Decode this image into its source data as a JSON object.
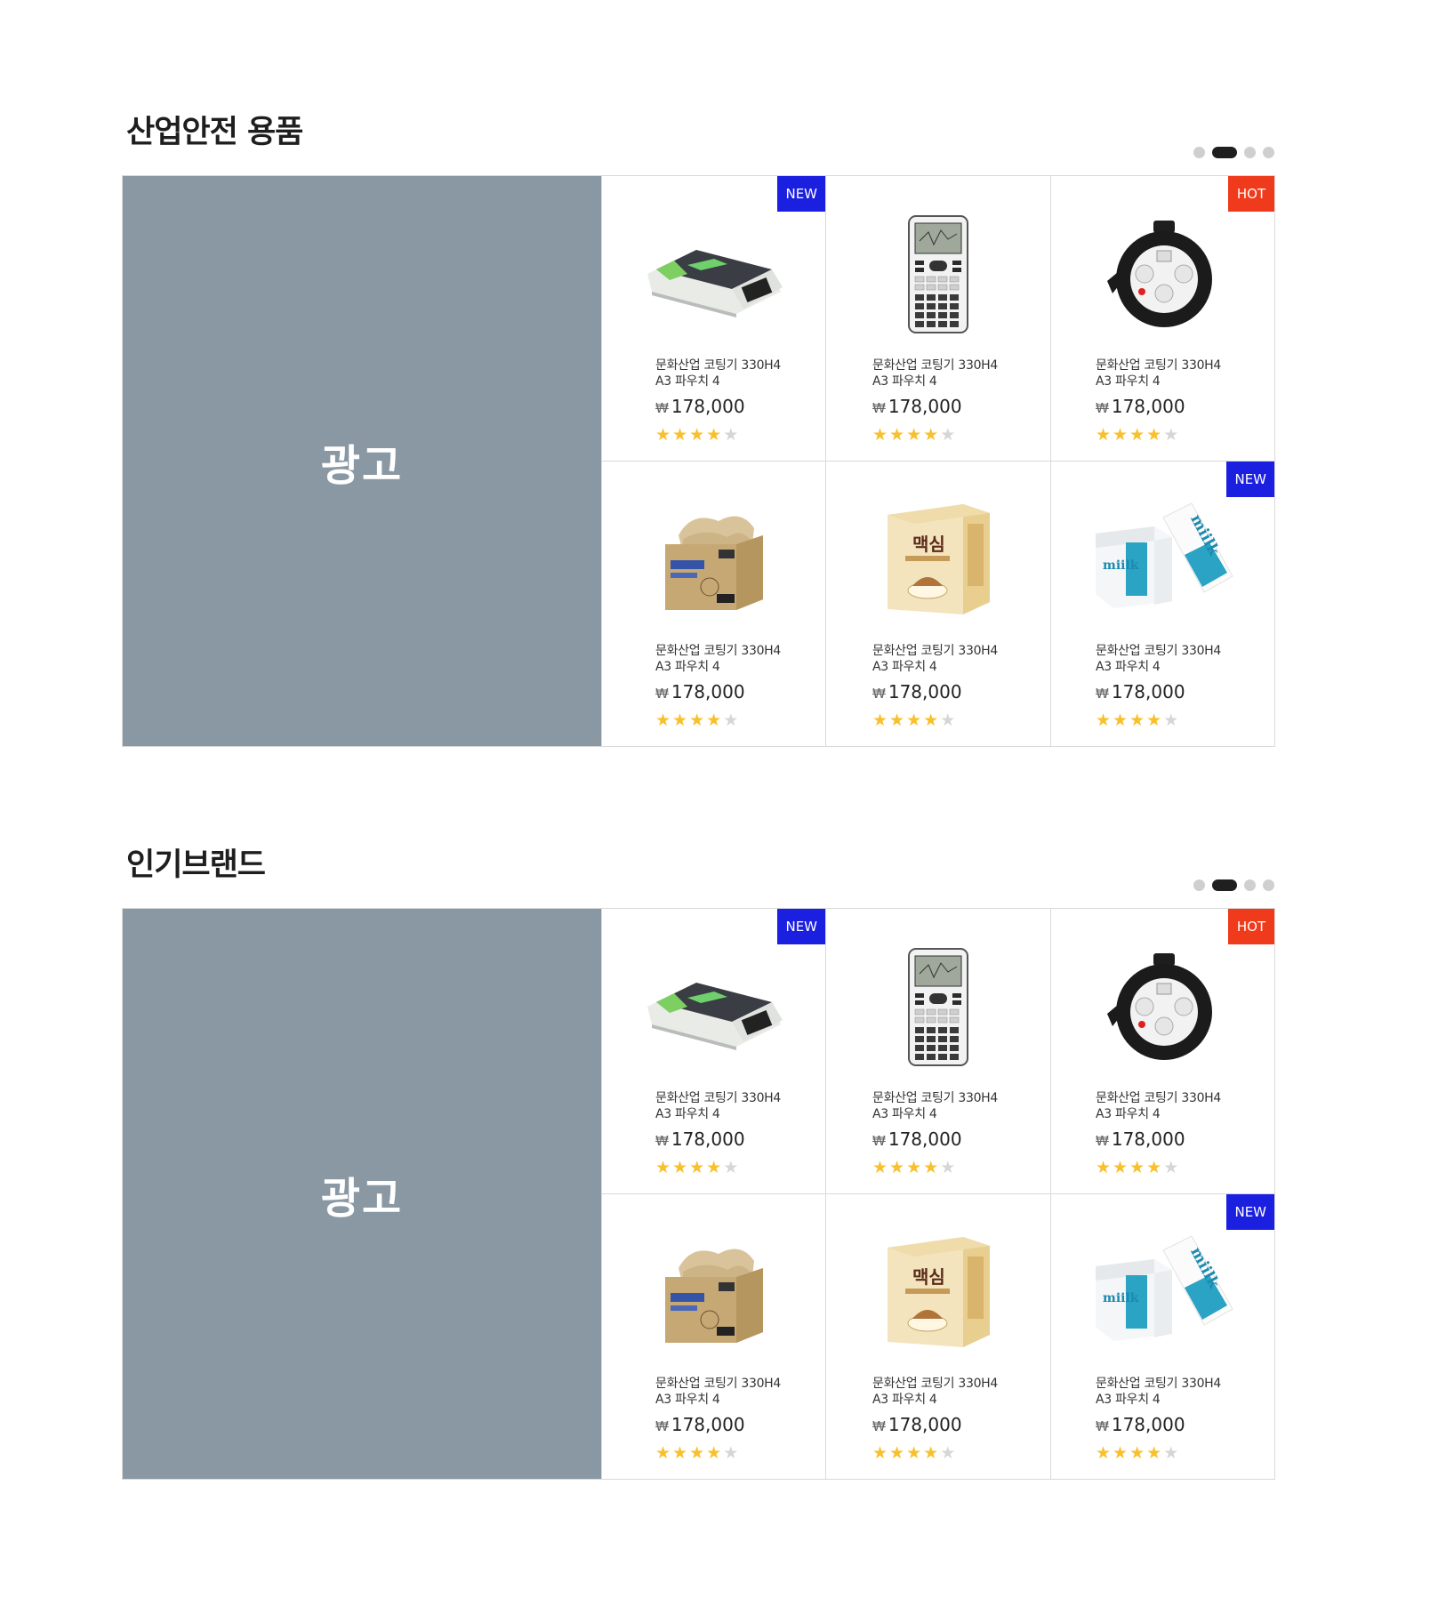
{
  "sections": [
    {
      "title": "산업안전 용품",
      "ad_label": "광고",
      "carousel": {
        "pages": 4,
        "active": 2
      },
      "products": [
        {
          "badge": "NEW",
          "badge_type": "new",
          "image": "laminator",
          "name_line1": "문화산업 코팅기 330H4",
          "name_line2": "A3 파우치 4",
          "currency": "₩",
          "price": "178,000",
          "rating": 4,
          "rating_max": 5
        },
        {
          "badge": "",
          "badge_type": "",
          "image": "calculator",
          "name_line1": "문화산업 코팅기 330H4",
          "name_line2": "A3 파우치 4",
          "currency": "₩",
          "price": "178,000",
          "rating": 4,
          "rating_max": 5
        },
        {
          "badge": "HOT",
          "badge_type": "hot",
          "image": "cord-reel",
          "name_line1": "문화산업 코팅기 330H4",
          "name_line2": "A3 파우치 4",
          "currency": "₩",
          "price": "178,000",
          "rating": 4,
          "rating_max": 5
        },
        {
          "badge": "",
          "badge_type": "",
          "image": "wiper-box",
          "name_line1": "문화산업 코팅기 330H4",
          "name_line2": "A3 파우치 4",
          "currency": "₩",
          "price": "178,000",
          "rating": 4,
          "rating_max": 5
        },
        {
          "badge": "",
          "badge_type": "",
          "image": "coffee-box",
          "image_text": "맥심",
          "name_line1": "문화산업 코팅기 330H4",
          "name_line2": "A3 파우치 4",
          "currency": "₩",
          "price": "178,000",
          "rating": 4,
          "rating_max": 5
        },
        {
          "badge": "NEW",
          "badge_type": "new",
          "image": "paper-box",
          "image_text": "miilk",
          "name_line1": "문화산업 코팅기 330H4",
          "name_line2": "A3 파우치 4",
          "currency": "₩",
          "price": "178,000",
          "rating": 4,
          "rating_max": 5
        }
      ]
    },
    {
      "title": "인기브랜드",
      "ad_label": "광고",
      "carousel": {
        "pages": 4,
        "active": 2
      },
      "products": [
        {
          "badge": "NEW",
          "badge_type": "new",
          "image": "laminator",
          "name_line1": "문화산업 코팅기 330H4",
          "name_line2": "A3 파우치 4",
          "currency": "₩",
          "price": "178,000",
          "rating": 4,
          "rating_max": 5
        },
        {
          "badge": "",
          "badge_type": "",
          "image": "calculator",
          "name_line1": "문화산업 코팅기 330H4",
          "name_line2": "A3 파우치 4",
          "currency": "₩",
          "price": "178,000",
          "rating": 4,
          "rating_max": 5
        },
        {
          "badge": "HOT",
          "badge_type": "hot",
          "image": "cord-reel",
          "name_line1": "문화산업 코팅기 330H4",
          "name_line2": "A3 파우치 4",
          "currency": "₩",
          "price": "178,000",
          "rating": 4,
          "rating_max": 5
        },
        {
          "badge": "",
          "badge_type": "",
          "image": "wiper-box",
          "name_line1": "문화산업 코팅기 330H4",
          "name_line2": "A3 파우치 4",
          "currency": "₩",
          "price": "178,000",
          "rating": 4,
          "rating_max": 5
        },
        {
          "badge": "",
          "badge_type": "",
          "image": "coffee-box",
          "image_text": "맥심",
          "name_line1": "문화산업 코팅기 330H4",
          "name_line2": "A3 파우치 4",
          "currency": "₩",
          "price": "178,000",
          "rating": 4,
          "rating_max": 5
        },
        {
          "badge": "NEW",
          "badge_type": "new",
          "image": "paper-box",
          "image_text": "miilk",
          "name_line1": "문화산업 코팅기 330H4",
          "name_line2": "A3 파우치 4",
          "currency": "₩",
          "price": "178,000",
          "rating": 4,
          "rating_max": 5
        }
      ]
    }
  ],
  "colors": {
    "ad_bg": "#8a98a3",
    "badge_new": "#1b1fe0",
    "badge_hot": "#ef3a1c",
    "star_on": "#f7c02c",
    "star_off": "#d6d6d6",
    "dot_active": "#1f1f1f",
    "dot_inactive": "#cfcfcf"
  }
}
